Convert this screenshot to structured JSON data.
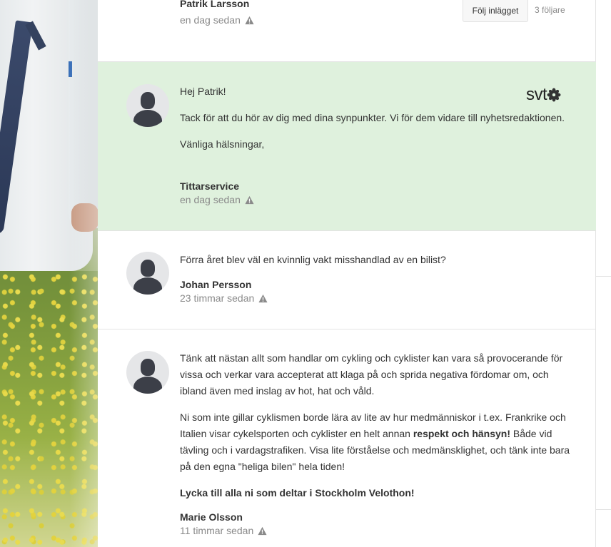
{
  "top_post": {
    "author": "Patrik Larsson",
    "time": "en dag sedan",
    "follow_label": "Följ inlägget",
    "followers": "3 följare"
  },
  "comments": [
    {
      "paragraphs": [
        "Hej Patrik!",
        "Tack för att du hör av dig med dina synpunkter. Vi för dem vidare till nyhetsredaktionen.",
        "Vänliga hälsningar,"
      ],
      "author": "Tittarservice",
      "time": "en dag sedan",
      "logo_text": "svt"
    },
    {
      "paragraphs": [
        "Förra året blev väl en kvinnlig vakt misshandlad av en bilist?"
      ],
      "author": "Johan Persson",
      "time": "23 timmar sedan"
    },
    {
      "paragraphs": [
        "Tänk att nästan allt som handlar om cykling och cyklister kan vara så provocerande för vissa och verkar vara accepterat att klaga på och sprida negativa fördomar om, och ibland även med inslag av hot, hat och våld.",
        "Ni som inte gillar cyklismen borde lära av lite av hur medmänniskor i t.ex. Frankrike och Italien visar cykelsporten och cyklister en helt annan",
        "respekt och hänsyn!",
        "Både vid tävling och i vardagstrafiken. Visa lite förståelse och medmänsklighet, och tänk inte bara på den egna \"heliga bilen\" hela tiden!",
        "Lycka till alla ni som deltar i Stockholm Velothon!"
      ],
      "author": "Marie Olsson",
      "time": "11 timmar sedan"
    }
  ],
  "colors": {
    "highlight_bg": "#dff1dd",
    "divider": "#e3e3e3",
    "meta_text": "#8a8a8a",
    "avatar_bg": "#e5e6e8",
    "avatar_fg": "#3c3f48"
  },
  "icons": [
    "warning-icon",
    "user-avatar-icon",
    "svt-flower-icon"
  ]
}
